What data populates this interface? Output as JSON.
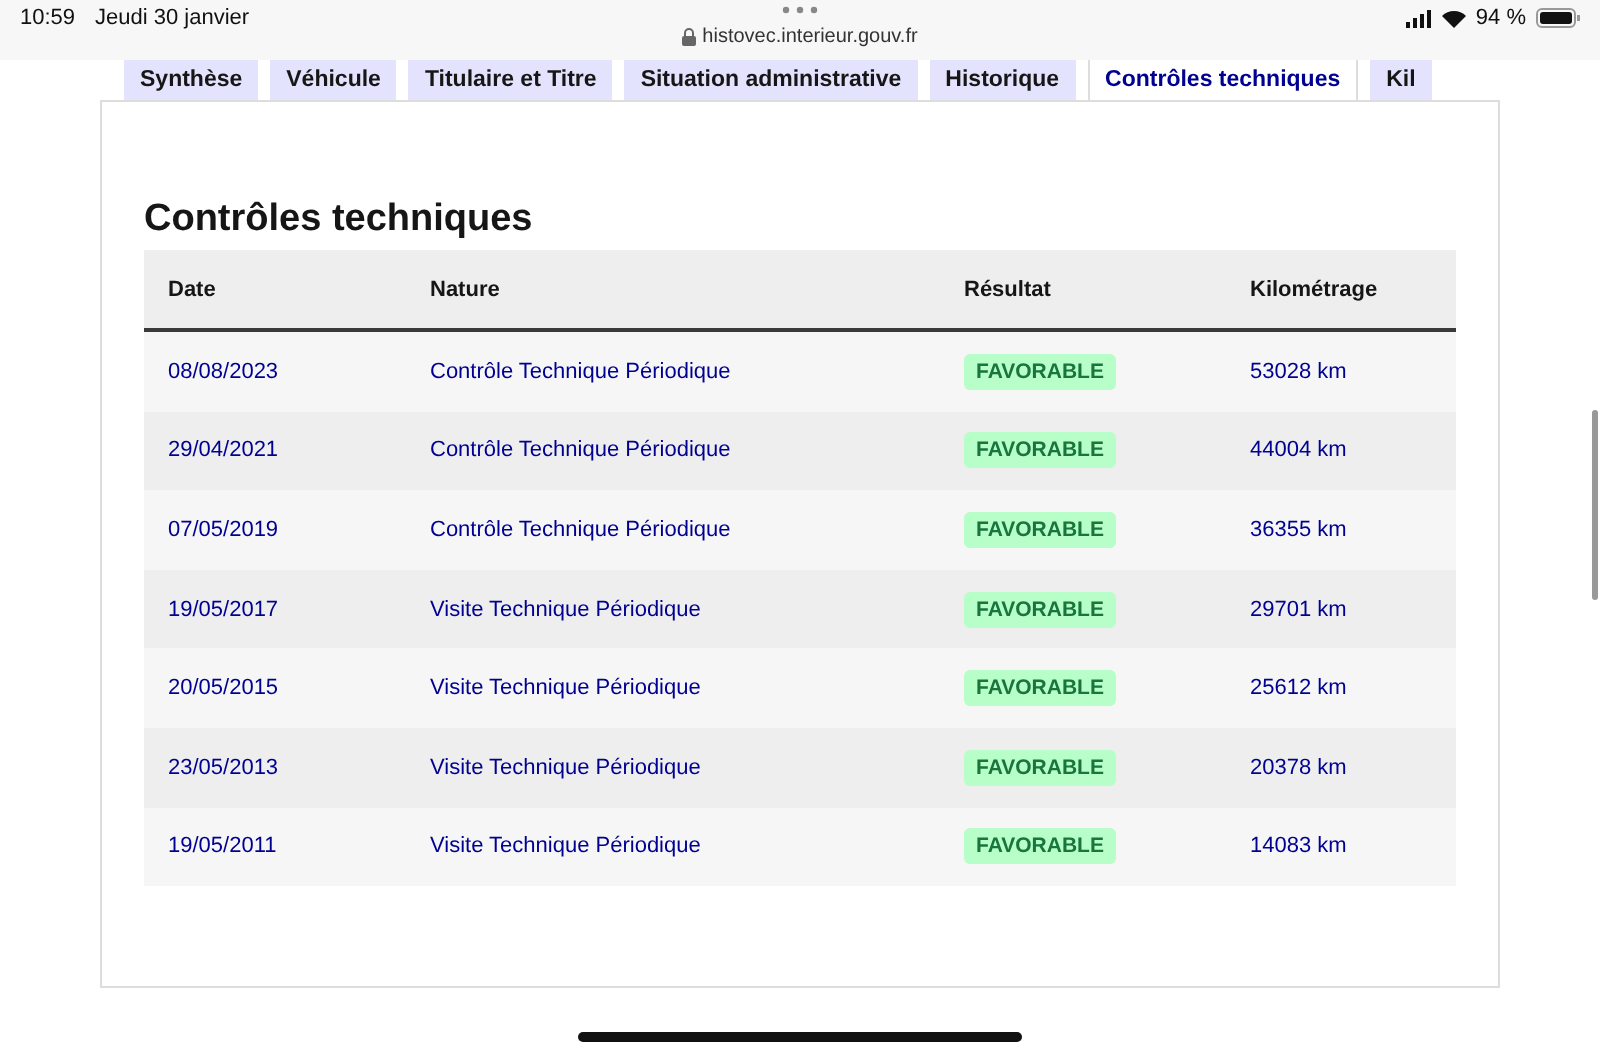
{
  "status_bar": {
    "time": "10:59",
    "date": "Jeudi 30 janvier",
    "battery": "94 %"
  },
  "address_bar": {
    "url": "histovec.interieur.gouv.fr"
  },
  "tabs": [
    {
      "label": "Synthèse",
      "selected": false
    },
    {
      "label": "Véhicule",
      "selected": false
    },
    {
      "label": "Titulaire et Titre",
      "selected": false
    },
    {
      "label": "Situation administrative",
      "selected": false
    },
    {
      "label": "Historique",
      "selected": false
    },
    {
      "label": "Contrôles techniques",
      "selected": true
    },
    {
      "label": "Kil",
      "selected": false
    }
  ],
  "section": {
    "title": "Contrôles techniques"
  },
  "table": {
    "columns": [
      "Date",
      "Nature",
      "Résultat",
      "Kilométrage"
    ],
    "rows": [
      {
        "date": "08/08/2023",
        "nature": "Contrôle Technique Périodique",
        "result": "FAVORABLE",
        "mileage": "53028 km"
      },
      {
        "date": "29/04/2021",
        "nature": "Contrôle Technique Périodique",
        "result": "FAVORABLE",
        "mileage": "44004 km"
      },
      {
        "date": "07/05/2019",
        "nature": "Contrôle Technique Périodique",
        "result": "FAVORABLE",
        "mileage": "36355 km"
      },
      {
        "date": "19/05/2017",
        "nature": "Visite Technique Périodique",
        "result": "FAVORABLE",
        "mileage": "29701 km"
      },
      {
        "date": "20/05/2015",
        "nature": "Visite Technique Périodique",
        "result": "FAVORABLE",
        "mileage": "25612 km"
      },
      {
        "date": "23/05/2013",
        "nature": "Visite Technique Périodique",
        "result": "FAVORABLE",
        "mileage": "20378 km"
      },
      {
        "date": "19/05/2011",
        "nature": "Visite Technique Périodique",
        "result": "FAVORABLE",
        "mileage": "14083 km"
      }
    ]
  }
}
